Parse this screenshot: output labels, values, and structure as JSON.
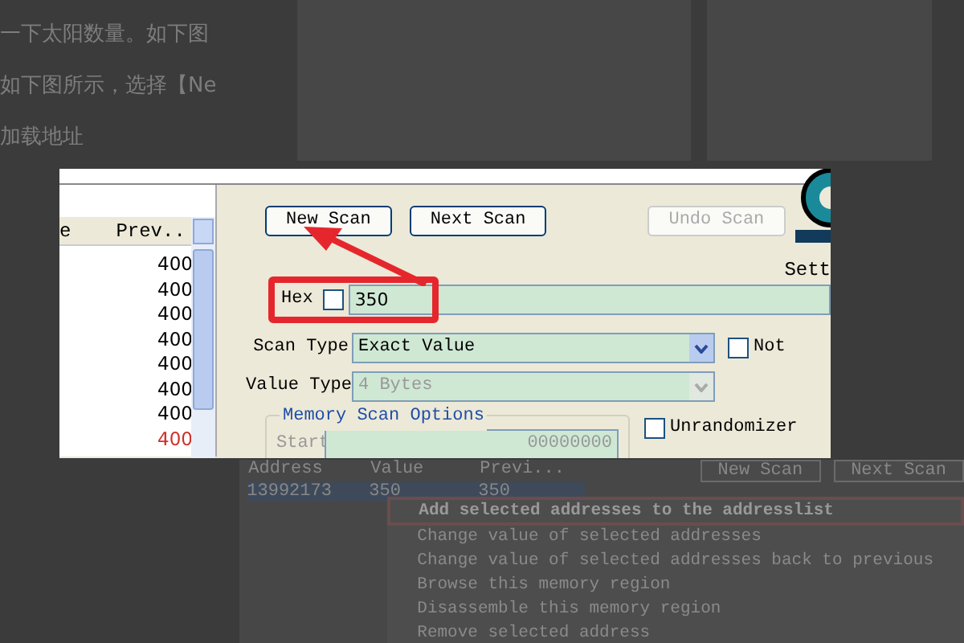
{
  "article_lines": [
    "一下太阳数量。如下图",
    "如下图所示，选择【Ne",
    "加载地址"
  ],
  "viewer": {
    "list": {
      "column_1": "e",
      "column_2": "Prev..",
      "values": [
        {
          "text": "400",
          "changed": false
        },
        {
          "text": "400",
          "changed": false
        },
        {
          "text": "400",
          "changed": false
        },
        {
          "text": "400",
          "changed": false
        },
        {
          "text": "400",
          "changed": false
        },
        {
          "text": "400",
          "changed": false
        },
        {
          "text": "400",
          "changed": false
        },
        {
          "text": "400",
          "changed": true
        }
      ]
    },
    "buttons": [
      {
        "label": "New Scan",
        "disabled": false
      },
      {
        "label": "Next Scan",
        "disabled": false
      },
      {
        "label": "Undo Scan",
        "disabled": true
      }
    ],
    "logo_caption": "Sett",
    "hex": {
      "label": "Hex",
      "checked": false,
      "value": "350"
    },
    "scan_type": {
      "label": "Scan Type",
      "value": "Exact Value",
      "disabled": false
    },
    "not": {
      "label": "Not",
      "checked": false
    },
    "value_type": {
      "label": "Value Type",
      "value": "4 Bytes",
      "disabled": true
    },
    "memory_scan_options": {
      "title": "Memory Scan Options",
      "start_label": "Start",
      "start_value": "00000000"
    },
    "unrandomizer": {
      "label": "Unrandomizer",
      "checked": false
    }
  },
  "background_screenshot": {
    "columns": [
      "Address",
      "Value",
      "Previ..."
    ],
    "row": [
      "13992173",
      "350",
      "350"
    ],
    "buttons": [
      "New Scan",
      "Next Scan"
    ],
    "menu": [
      {
        "label": "Add selected addresses to the addresslist",
        "highlighted": true
      },
      {
        "label": "Change value of selected addresses",
        "highlighted": false
      },
      {
        "label": "Change value of selected addresses back to previous",
        "highlighted": false
      },
      {
        "label": "Browse this memory region",
        "highlighted": false
      },
      {
        "label": "Disassemble this memory region",
        "highlighted": false
      },
      {
        "label": "Remove selected address",
        "highlighted": false
      }
    ]
  }
}
